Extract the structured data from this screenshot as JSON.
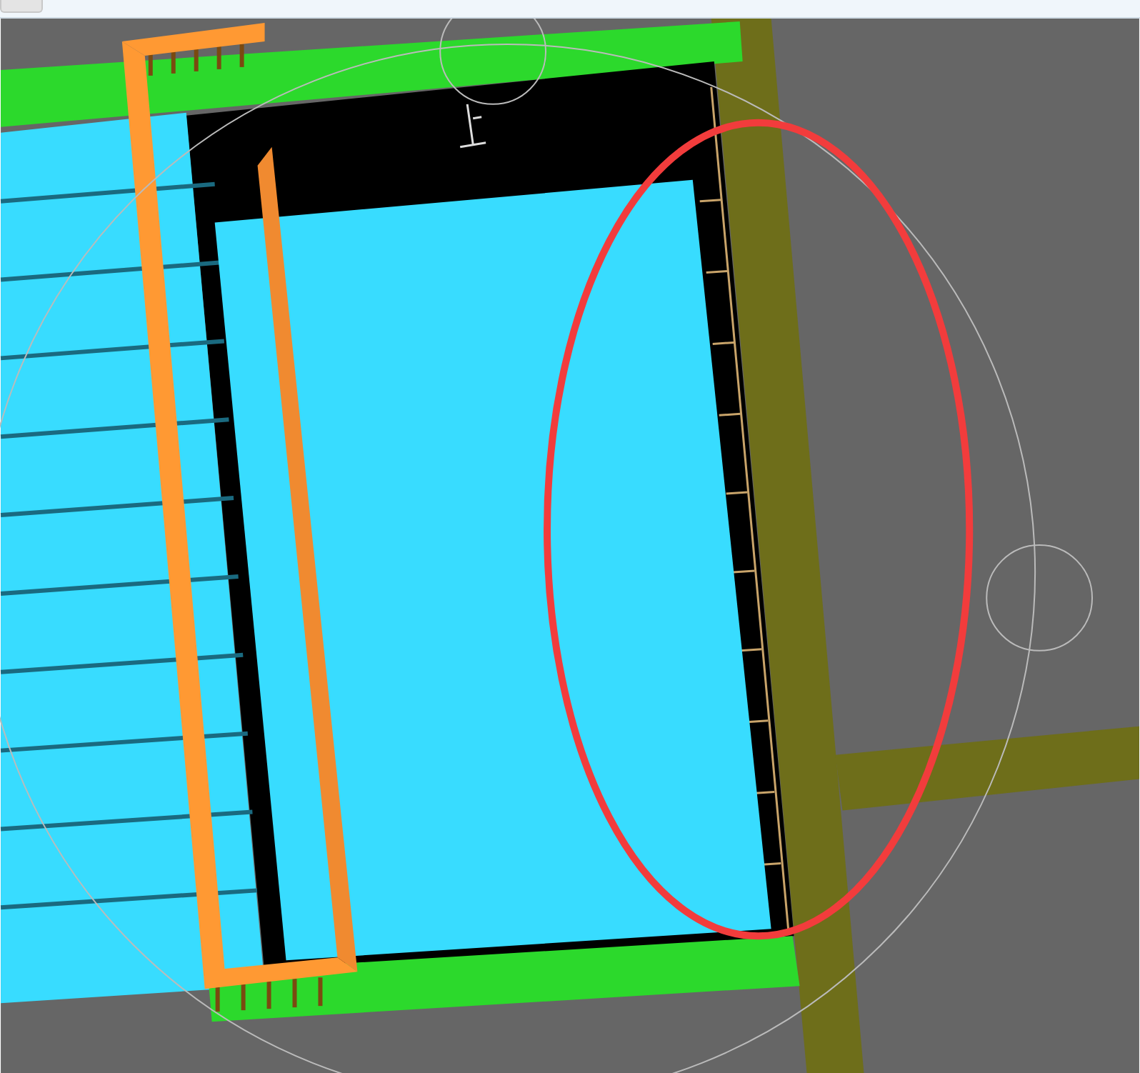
{
  "viewport": {
    "highlight_ellipse": true
  }
}
